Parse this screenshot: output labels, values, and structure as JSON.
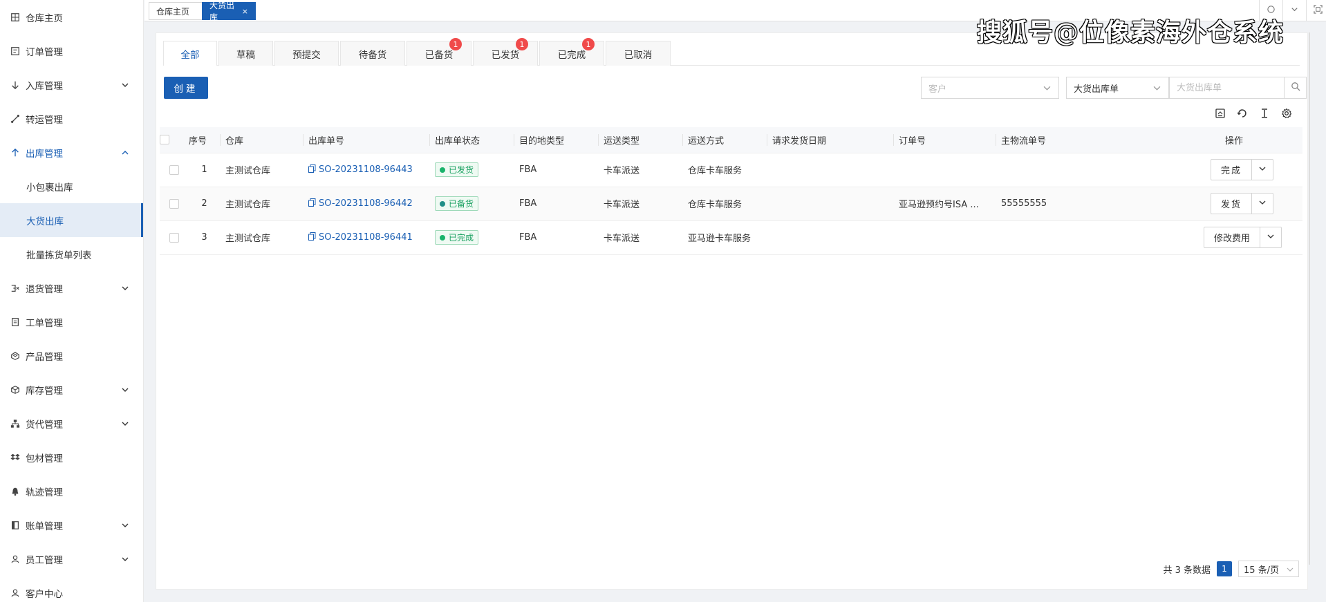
{
  "sidebar": {
    "items": [
      {
        "label": "仓库主页",
        "icon": "grid-icon"
      },
      {
        "label": "订单管理",
        "icon": "order-icon"
      },
      {
        "label": "入库管理",
        "icon": "arrow-down-icon"
      },
      {
        "label": "转运管理",
        "icon": "transfer-icon"
      },
      {
        "label": "出库管理",
        "icon": "arrow-up-icon"
      },
      {
        "label": "小包裹出库"
      },
      {
        "label": "大货出库"
      },
      {
        "label": "批量拣货单列表"
      },
      {
        "label": "退货管理",
        "icon": "return-icon"
      },
      {
        "label": "工单管理",
        "icon": "document-icon"
      },
      {
        "label": "产品管理",
        "icon": "product-icon"
      },
      {
        "label": "库存管理",
        "icon": "box-icon"
      },
      {
        "label": "货代管理",
        "icon": "sitemap-icon"
      },
      {
        "label": "包材管理",
        "icon": "dropbox-icon"
      },
      {
        "label": "轨迹管理",
        "icon": "bell-icon"
      },
      {
        "label": "账单管理",
        "icon": "bill-icon"
      },
      {
        "label": "员工管理",
        "icon": "user-icon"
      },
      {
        "label": "客户中心",
        "icon": "customer-icon"
      }
    ]
  },
  "page_tabs": [
    {
      "label": "仓库主页"
    },
    {
      "label": "大货出库",
      "close": "×"
    }
  ],
  "watermark": "搜狐号@位像素海外仓系统",
  "status_tabs": [
    {
      "label": "全部"
    },
    {
      "label": "草稿"
    },
    {
      "label": "预提交"
    },
    {
      "label": "待备货"
    },
    {
      "label": "已备货",
      "badge": "1"
    },
    {
      "label": "已发货",
      "badge": "1"
    },
    {
      "label": "已完成",
      "badge": "1"
    },
    {
      "label": "已取消"
    }
  ],
  "toolbar": {
    "create_label": "创建",
    "customer_placeholder": "客户",
    "type_select_value": "大货出库单",
    "search_placeholder": "大货出库单"
  },
  "table": {
    "headers": [
      "序号",
      "仓库",
      "出库单号",
      "出库单状态",
      "目的地类型",
      "运送类型",
      "运送方式",
      "请求发货日期",
      "订单号",
      "主物流单号",
      "操作"
    ],
    "rows": [
      {
        "no": "1",
        "warehouse": "主测试仓库",
        "so": "SO-20231108-96443",
        "status": "已发货",
        "dest": "FBA",
        "ship_type": "卡车派送",
        "ship_method": "仓库卡车服务",
        "req_date": "",
        "order_no": "",
        "tracking": "",
        "action": "完成"
      },
      {
        "no": "2",
        "warehouse": "主测试仓库",
        "so": "SO-20231108-96442",
        "status": "已备货",
        "dest": "FBA",
        "ship_type": "卡车派送",
        "ship_method": "仓库卡车服务",
        "req_date": "",
        "order_no": "亚马逊预约号ISA ...",
        "tracking": "55555555",
        "action": "发货"
      },
      {
        "no": "3",
        "warehouse": "主测试仓库",
        "so": "SO-20231108-96441",
        "status": "已完成",
        "dest": "FBA",
        "ship_type": "卡车派送",
        "ship_method": "亚马逊卡车服务",
        "req_date": "",
        "order_no": "",
        "tracking": "",
        "action": "修改费用"
      }
    ]
  },
  "pagination": {
    "total_text": "共 3 条数据",
    "current_page": "1",
    "page_size": "15 条/页"
  }
}
